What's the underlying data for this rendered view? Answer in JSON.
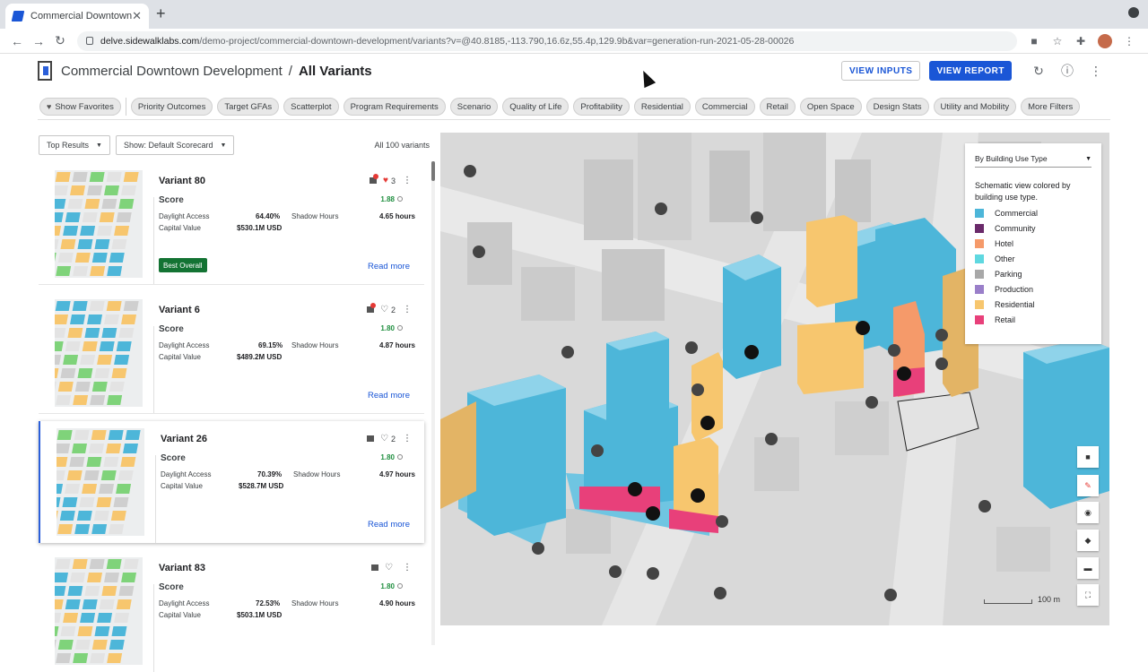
{
  "browser": {
    "tab_title": "Commercial Downtown Development",
    "url_host": "delve.sidewalklabs.com",
    "url_path": "/demo-project/commercial-downtown-development/variants?v=@40.8185,-113.790,16.6z,55.4p,129.9b&var=generation-run-2021-05-28-00026"
  },
  "header": {
    "project": "Commercial Downtown Development",
    "separator": "/",
    "page": "All Variants",
    "view_inputs": "VIEW INPUTS",
    "view_report": "VIEW REPORT"
  },
  "filters": [
    "Show Favorites",
    "Priority Outcomes",
    "Target GFAs",
    "Scatterplot",
    "Program Requirements",
    "Scenario",
    "Quality of Life",
    "Profitability",
    "Residential",
    "Commercial",
    "Retail",
    "Open Space",
    "Design Stats",
    "Utility and Mobility",
    "More Filters"
  ],
  "list": {
    "sort": "Top Results",
    "scorecard": "Show: Default Scorecard",
    "count": "All 100 variants"
  },
  "variants": [
    {
      "name": "Variant 80",
      "favorites": "3",
      "score_label": "Score",
      "score": "1.88",
      "daylight_label": "Daylight Access",
      "daylight": "64.40%",
      "shadow_label": "Shadow Hours",
      "shadow": "4.65 hours",
      "capital_label": "Capital Value",
      "capital": "$530.1M USD",
      "badge": "Best Overall",
      "read_more": "Read more"
    },
    {
      "name": "Variant 6",
      "favorites": "2",
      "score_label": "Score",
      "score": "1.80",
      "daylight_label": "Daylight Access",
      "daylight": "69.15%",
      "shadow_label": "Shadow Hours",
      "shadow": "4.87 hours",
      "capital_label": "Capital Value",
      "capital": "$489.2M USD",
      "read_more": "Read more"
    },
    {
      "name": "Variant 26",
      "favorites": "2",
      "score_label": "Score",
      "score": "1.80",
      "daylight_label": "Daylight Access",
      "daylight": "70.39%",
      "shadow_label": "Shadow Hours",
      "shadow": "4.97 hours",
      "capital_label": "Capital Value",
      "capital": "$528.7M USD",
      "read_more": "Read more"
    },
    {
      "name": "Variant 83",
      "favorites": "",
      "score_label": "Score",
      "score": "1.80",
      "daylight_label": "Daylight Access",
      "daylight": "72.53%",
      "shadow_label": "Shadow Hours",
      "shadow": "4.90 hours",
      "capital_label": "Capital Value",
      "capital": "$503.1M USD"
    }
  ],
  "legend": {
    "selector": "By Building Use Type",
    "description": "Schematic view colored by building use type.",
    "items": [
      {
        "label": "Commercial",
        "color": "#4db6d9"
      },
      {
        "label": "Community",
        "color": "#6a2a6a"
      },
      {
        "label": "Hotel",
        "color": "#f59a6a"
      },
      {
        "label": "Other",
        "color": "#5fd8e0"
      },
      {
        "label": "Parking",
        "color": "#a8a8a8"
      },
      {
        "label": "Production",
        "color": "#9a7fc9"
      },
      {
        "label": "Residential",
        "color": "#f7c66e"
      },
      {
        "label": "Retail",
        "color": "#e8407a"
      }
    ]
  },
  "map": {
    "scale_label": "100 m"
  }
}
